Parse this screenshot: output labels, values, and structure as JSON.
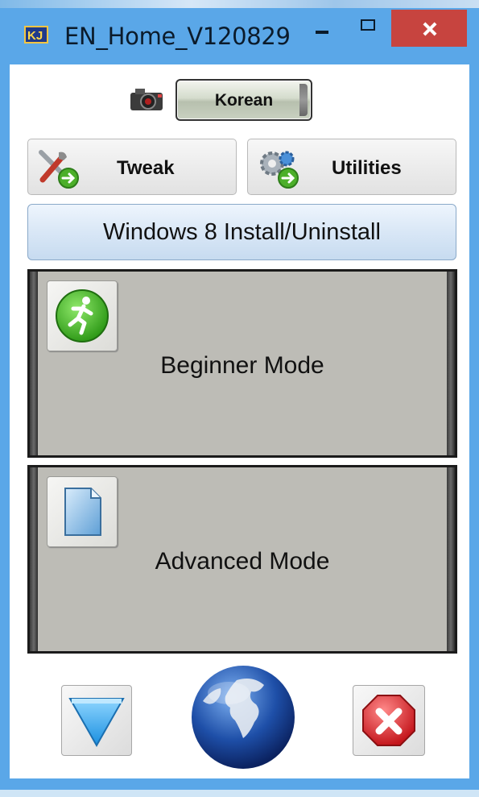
{
  "window": {
    "title": "EN_Home_V120829",
    "app_icon": "kj-app-icon",
    "controls": [
      "minimize-icon",
      "maximize-icon",
      "close-icon"
    ]
  },
  "language": {
    "icon": "camera-icon",
    "button_label": "Korean"
  },
  "tools": {
    "tweak_label": "Tweak",
    "tweak_icon": "tweak-tools-icon",
    "utilities_label": "Utilities",
    "utilities_icon": "gear-utilities-icon"
  },
  "install": {
    "label": "Windows 8 Install/Uninstall"
  },
  "modes": {
    "beginner_label": "Beginner Mode",
    "beginner_icon": "running-man-icon",
    "advanced_label": "Advanced Mode",
    "advanced_icon": "document-icon"
  },
  "bottom": {
    "down_icon": "down-triangle-icon",
    "globe_icon": "globe-icon",
    "exit_icon": "red-x-stop-icon"
  },
  "colors": {
    "titlebar": "#5aa7e8",
    "close_button": "#c7443f",
    "mode_panel": "#bdbcb6",
    "install_button": "#d9e7f6"
  }
}
